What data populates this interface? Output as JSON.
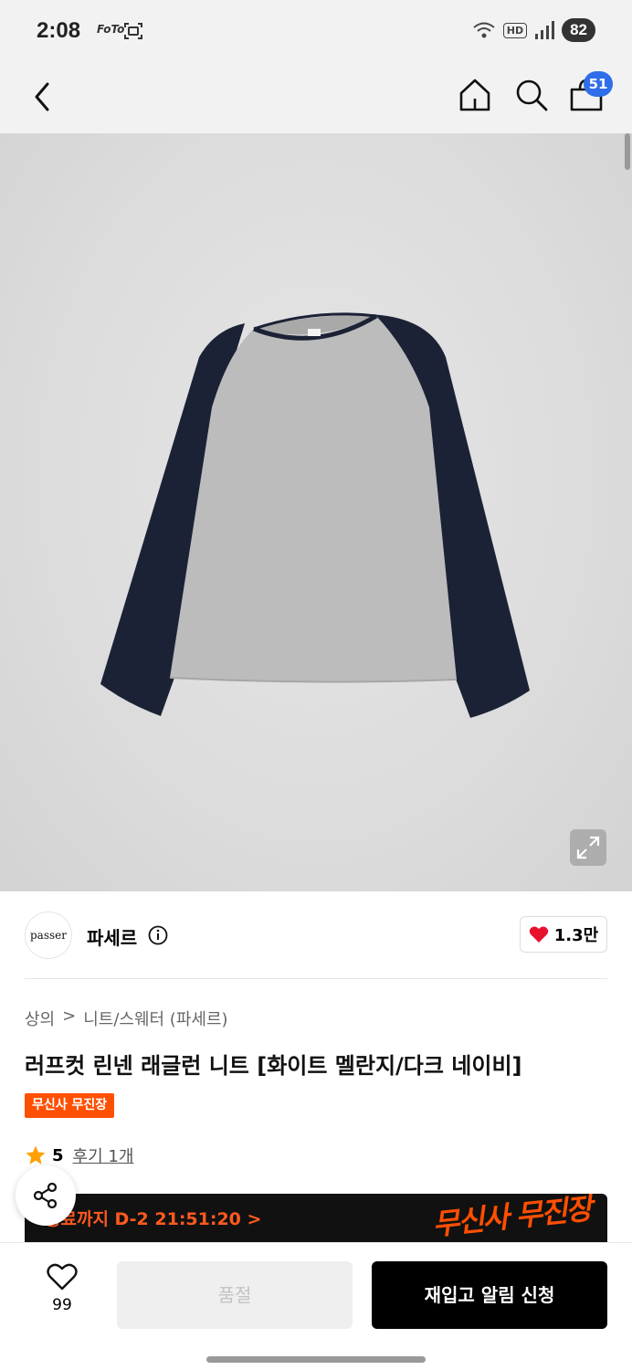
{
  "status_bar": {
    "time": "2:08",
    "small_label": "FoTo",
    "battery": "82",
    "hd_label": "HD"
  },
  "header": {
    "cart_count": "51"
  },
  "brand": {
    "logo_text": "passer",
    "name": "파세르",
    "like_count": "1.3만"
  },
  "breadcrumb": {
    "category": "상의",
    "separator": ">",
    "subcategory": "니트/스웨터 (파세르)"
  },
  "product": {
    "title": "러프컷 린넨 래글런 니트 [화이트 멜란지/다크 네이비]",
    "promo_badge": "무신사 무진장",
    "rating": "5",
    "review_label": "후기 1개"
  },
  "event_banner": {
    "countdown": "종료까지 D-2 21:51:20 >",
    "logo_text": "무신사 무진장"
  },
  "bottom_bar": {
    "wish_count": "99",
    "soldout_label": "품절",
    "restock_label": "재입고 알림 신청"
  },
  "colors": {
    "accent_orange": "#ff4f00",
    "badge_blue": "#2f6ee8",
    "heart_red": "#e8112d",
    "star": "#ffa000"
  }
}
